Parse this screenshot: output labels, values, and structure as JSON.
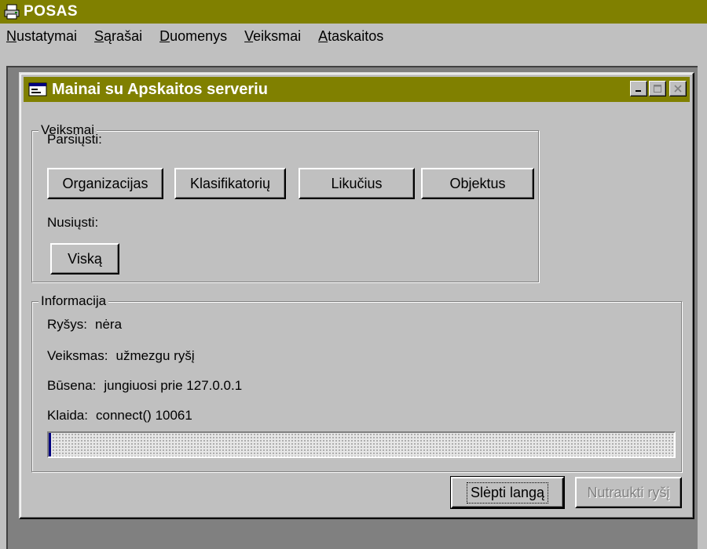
{
  "app": {
    "title": "POSAS",
    "icon": "printer-icon"
  },
  "menubar": {
    "items": [
      {
        "mnemonic": "N",
        "rest": "ustatymai"
      },
      {
        "mnemonic": "S",
        "rest": "ąrašai"
      },
      {
        "mnemonic": "D",
        "rest": "uomenys"
      },
      {
        "mnemonic": "V",
        "rest": "eiksmai"
      },
      {
        "mnemonic": "A",
        "rest": "taskaitos"
      }
    ]
  },
  "child_window": {
    "title": "Mainai su Apskaitos serveriu",
    "icon": "window-icon",
    "buttons": {
      "minimize": "minimize-icon",
      "maximize": "maximize-icon",
      "close": "close-icon"
    }
  },
  "actions_group": {
    "legend": "Veiksmai",
    "download_label": "Parsiųsti:",
    "download_buttons": [
      "Organizacijas",
      "Klasifikatorių",
      "Likučius",
      "Objektus"
    ],
    "upload_label": "Nusiųsti:",
    "upload_button": "Viską"
  },
  "info_group": {
    "legend": "Informacija",
    "rows": [
      {
        "label": "Ryšys:",
        "value": "nėra"
      },
      {
        "label": "Veiksmas:",
        "value": "užmezgu ryšį"
      },
      {
        "label": "Būsena:",
        "value": "jungiuosi prie 127.0.0.1"
      },
      {
        "label": "Klaida:",
        "value": "connect() 10061"
      }
    ],
    "progress": 0.004
  },
  "footer": {
    "hide_window": "Slėpti langą",
    "disconnect": "Nutraukti ryšį"
  },
  "colors": {
    "titlebar": "#808000",
    "face": "#c0c0c0",
    "mdi_background": "#808080"
  }
}
